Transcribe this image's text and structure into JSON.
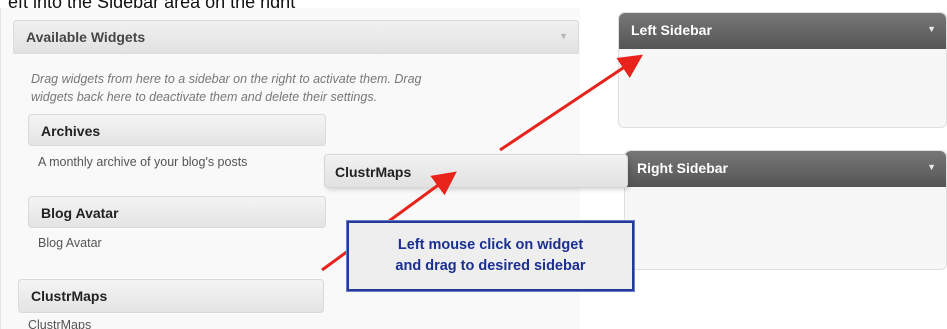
{
  "caption": "eft into the Sidebar area on the right",
  "available_widgets": {
    "title": "Available Widgets",
    "description_line1": "Drag widgets from here to a sidebar on the right to activate them. Drag",
    "description_line2": "widgets back here to deactivate them and delete their settings.",
    "widgets": [
      {
        "title": "Archives",
        "description": "A monthly archive of your blog's posts"
      },
      {
        "title": "Blog Avatar",
        "description": "Blog Avatar"
      },
      {
        "title": "ClustrMaps",
        "description": "ClustrMaps"
      }
    ]
  },
  "sidebars": [
    {
      "title": "Left Sidebar"
    },
    {
      "title": "Right Sidebar"
    }
  ],
  "dragged_widget": {
    "title": "ClustrMaps"
  },
  "callout": {
    "line1": "Left mouse click on widget",
    "line2": "and drag to desired sidebar"
  },
  "colors": {
    "arrow": "#e8231c",
    "callout_border": "#233a9a",
    "callout_text": "#1b2f91",
    "sidebar_header": "#555555"
  },
  "icons": {
    "panel_toggle": "chevron-down-icon",
    "sidebar_toggle": "chevron-down-icon"
  }
}
